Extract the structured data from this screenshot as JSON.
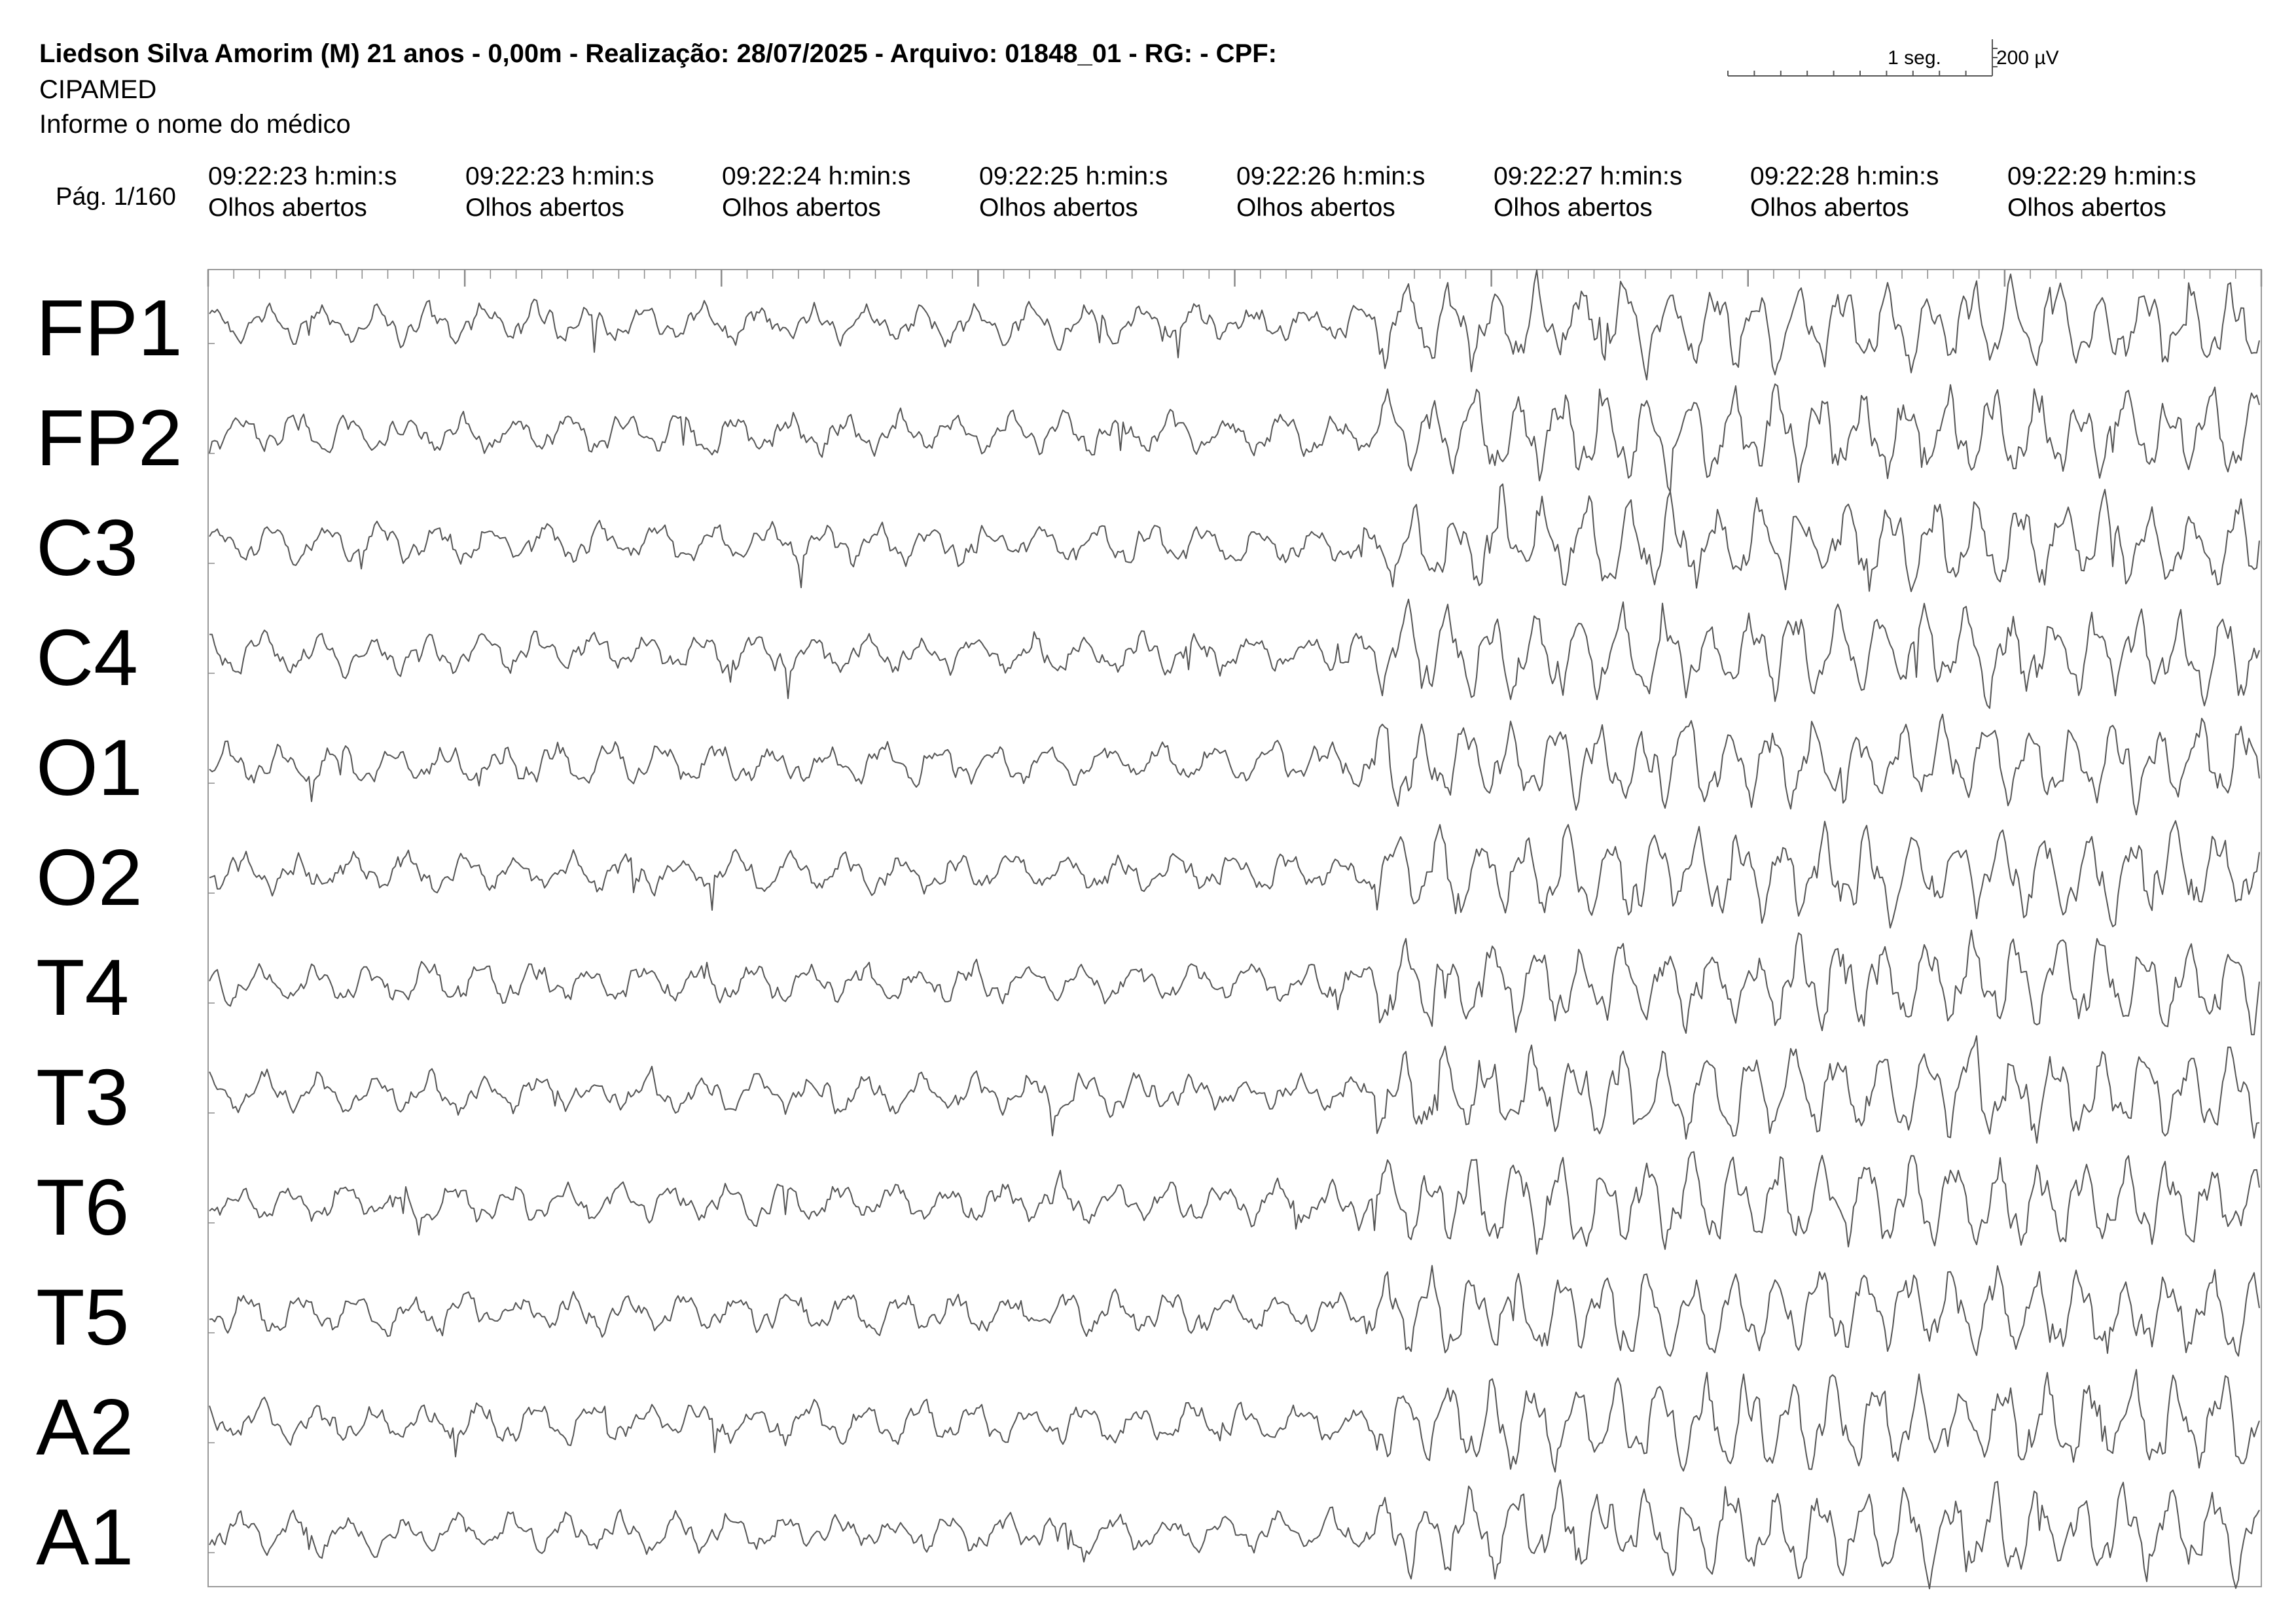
{
  "header": {
    "title": "Liedson Silva Amorim (M) 21 anos - 0,00m - Realização: 28/07/2025 - Arquivo: 01848_01 - RG:  - CPF:",
    "org": "CIPAMED",
    "doctor": "Informe o nome do médico"
  },
  "scale": {
    "time_label": "1 seg.",
    "amplitude_label": "200 µV"
  },
  "page": "Pág. 1/160",
  "time_columns": [
    {
      "time": "09:22:23 h:min:s",
      "state": "Olhos abertos"
    },
    {
      "time": "09:22:23 h:min:s",
      "state": "Olhos abertos"
    },
    {
      "time": "09:22:24 h:min:s",
      "state": "Olhos abertos"
    },
    {
      "time": "09:22:25 h:min:s",
      "state": "Olhos abertos"
    },
    {
      "time": "09:22:26 h:min:s",
      "state": "Olhos abertos"
    },
    {
      "time": "09:22:27 h:min:s",
      "state": "Olhos abertos"
    },
    {
      "time": "09:22:28 h:min:s",
      "state": "Olhos abertos"
    },
    {
      "time": "09:22:29 h:min:s",
      "state": "Olhos abertos"
    }
  ],
  "chart_data": {
    "type": "line",
    "channels": [
      "FP1",
      "FP2",
      "C3",
      "C4",
      "O1",
      "O2",
      "T4",
      "T3",
      "T6",
      "T5",
      "A2",
      "A1"
    ],
    "duration_seconds": 8,
    "high_amplitude_onset_seconds": 4.55,
    "trace_color": "#555555",
    "grid": false
  }
}
